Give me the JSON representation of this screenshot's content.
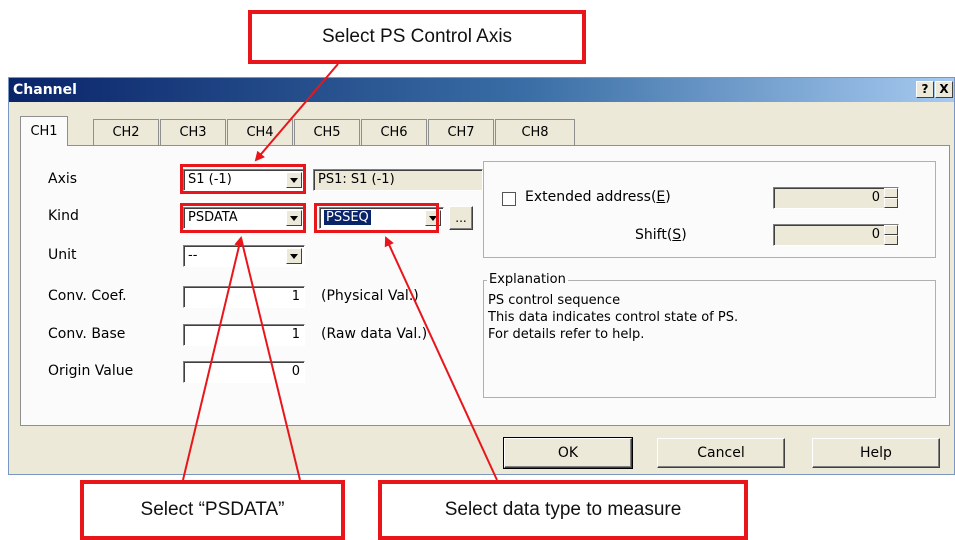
{
  "annotations": {
    "top": "Select PS Control Axis",
    "bottom_left": "Select “PSDATA”",
    "bottom_right": "Select data type to measure"
  },
  "dialog": {
    "title": "Channel",
    "help_btn": "?",
    "close_btn": "X",
    "tabs": [
      "CH1",
      "CH2",
      "CH3",
      "CH4",
      "CH5",
      "CH6",
      "CH7",
      "CH8"
    ],
    "active_tab": "CH1",
    "labels": {
      "axis": "Axis",
      "kind": "Kind",
      "unit": "Unit",
      "conv_coef": "Conv. Coef.",
      "conv_base": "Conv. Base",
      "origin": "Origin Value"
    },
    "values": {
      "axis": "S1 (-1)",
      "axis_info": "PS1: S1 (-1)",
      "kind": "PSDATA",
      "kind_sub": "PSSEQ",
      "browse": "...",
      "unit": "--",
      "conv_coef": "1",
      "conv_coef_note": "(Physical Val.)",
      "conv_base": "1",
      "conv_base_note": "(Raw data Val.)",
      "origin": "0"
    },
    "extended": {
      "checkbox_label_prefix": "Extended address(",
      "checkbox_key": "E",
      "checkbox_label_suffix": ")",
      "address_value": "0",
      "shift_prefix": "Shift(",
      "shift_key": "S",
      "shift_suffix": ")",
      "shift_value": "0"
    },
    "explanation": {
      "title": "Explanation",
      "lines": [
        "PS control sequence",
        "This data indicates control state of PS.",
        "For details refer to help."
      ]
    },
    "buttons": {
      "ok": "OK",
      "cancel": "Cancel",
      "help": "Help"
    }
  }
}
